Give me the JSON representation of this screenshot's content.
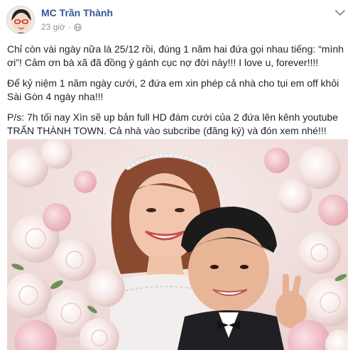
{
  "post": {
    "author": "MC Trần Thành",
    "time": "23 giờ",
    "separator": "·",
    "privacy_icon": "globe-icon",
    "options_icon": "chevron-down-icon",
    "paragraphs": [
      "Chỉ còn vài ngày nữa là 25/12 rồi, đúng 1 năm hai đứa gọi nhau tiếng: “mình ơi”! Cảm ơn bà xã đã đồng ý gánh cục nợ đời này!!! I love u, forever!!!!",
      "Để kỷ niệm 1 năm ngày cưới, 2 đứa em xin phép cả nhà cho tụi em off khỏi Sài Gòn 4 ngày nha!!!",
      "P/s: 7h tối nay Xìn sẽ up bản full HD đám cưới của 2 đứa lên kênh youtube TRẤN THÀNH TOWN. Cả nhà vào subcribe (đăng ký) và đón xem nhé!!!"
    ]
  },
  "colors": {
    "author": "#365899",
    "meta": "#90949c",
    "text": "#1d2129"
  }
}
